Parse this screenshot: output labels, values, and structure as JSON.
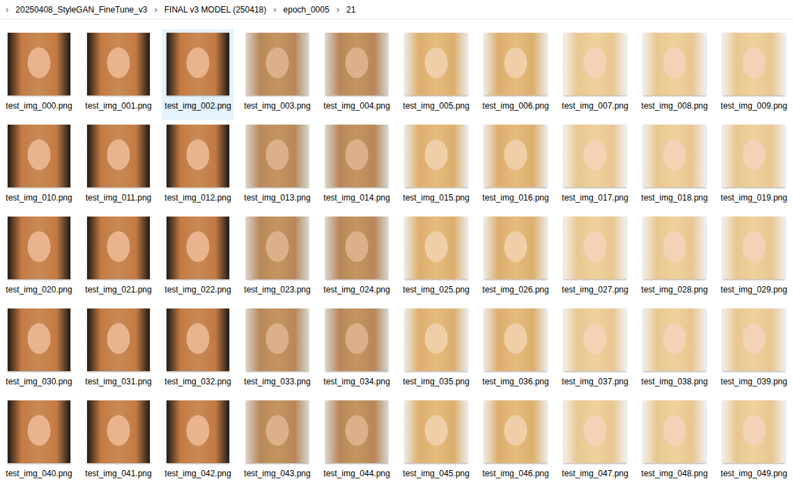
{
  "breadcrumb": {
    "separator": "›",
    "items": [
      "20250408_StyleGAN_FineTune_v3",
      "FINAL v3 MODEL (250418)",
      "epoch_0005",
      "21"
    ]
  },
  "files": [
    {
      "name": "test_img_000.png",
      "selected": false
    },
    {
      "name": "test_img_001.png",
      "selected": false
    },
    {
      "name": "test_img_002.png",
      "selected": true
    },
    {
      "name": "test_img_003.png",
      "selected": false
    },
    {
      "name": "test_img_004.png",
      "selected": false
    },
    {
      "name": "test_img_005.png",
      "selected": false
    },
    {
      "name": "test_img_006.png",
      "selected": false
    },
    {
      "name": "test_img_007.png",
      "selected": false
    },
    {
      "name": "test_img_008.png",
      "selected": false
    },
    {
      "name": "test_img_009.png",
      "selected": false
    },
    {
      "name": "test_img_010.png",
      "selected": false
    },
    {
      "name": "test_img_011.png",
      "selected": false
    },
    {
      "name": "test_img_012.png",
      "selected": false
    },
    {
      "name": "test_img_013.png",
      "selected": false
    },
    {
      "name": "test_img_014.png",
      "selected": false
    },
    {
      "name": "test_img_015.png",
      "selected": false
    },
    {
      "name": "test_img_016.png",
      "selected": false
    },
    {
      "name": "test_img_017.png",
      "selected": false
    },
    {
      "name": "test_img_018.png",
      "selected": false
    },
    {
      "name": "test_img_019.png",
      "selected": false
    },
    {
      "name": "test_img_020.png",
      "selected": false
    },
    {
      "name": "test_img_021.png",
      "selected": false
    },
    {
      "name": "test_img_022.png",
      "selected": false
    },
    {
      "name": "test_img_023.png",
      "selected": false
    },
    {
      "name": "test_img_024.png",
      "selected": false
    },
    {
      "name": "test_img_025.png",
      "selected": false
    },
    {
      "name": "test_img_026.png",
      "selected": false
    },
    {
      "name": "test_img_027.png",
      "selected": false
    },
    {
      "name": "test_img_028.png",
      "selected": false
    },
    {
      "name": "test_img_029.png",
      "selected": false
    },
    {
      "name": "test_img_030.png",
      "selected": false
    },
    {
      "name": "test_img_031.png",
      "selected": false
    },
    {
      "name": "test_img_032.png",
      "selected": false
    },
    {
      "name": "test_img_033.png",
      "selected": false
    },
    {
      "name": "test_img_034.png",
      "selected": false
    },
    {
      "name": "test_img_035.png",
      "selected": false
    },
    {
      "name": "test_img_036.png",
      "selected": false
    },
    {
      "name": "test_img_037.png",
      "selected": false
    },
    {
      "name": "test_img_038.png",
      "selected": false
    },
    {
      "name": "test_img_039.png",
      "selected": false
    },
    {
      "name": "test_img_040.png",
      "selected": false
    },
    {
      "name": "test_img_041.png",
      "selected": false
    },
    {
      "name": "test_img_042.png",
      "selected": false
    },
    {
      "name": "test_img_043.png",
      "selected": false
    },
    {
      "name": "test_img_044.png",
      "selected": false
    },
    {
      "name": "test_img_045.png",
      "selected": false
    },
    {
      "name": "test_img_046.png",
      "selected": false
    },
    {
      "name": "test_img_047.png",
      "selected": false
    },
    {
      "name": "test_img_048.png",
      "selected": false
    },
    {
      "name": "test_img_049.png",
      "selected": false
    }
  ]
}
